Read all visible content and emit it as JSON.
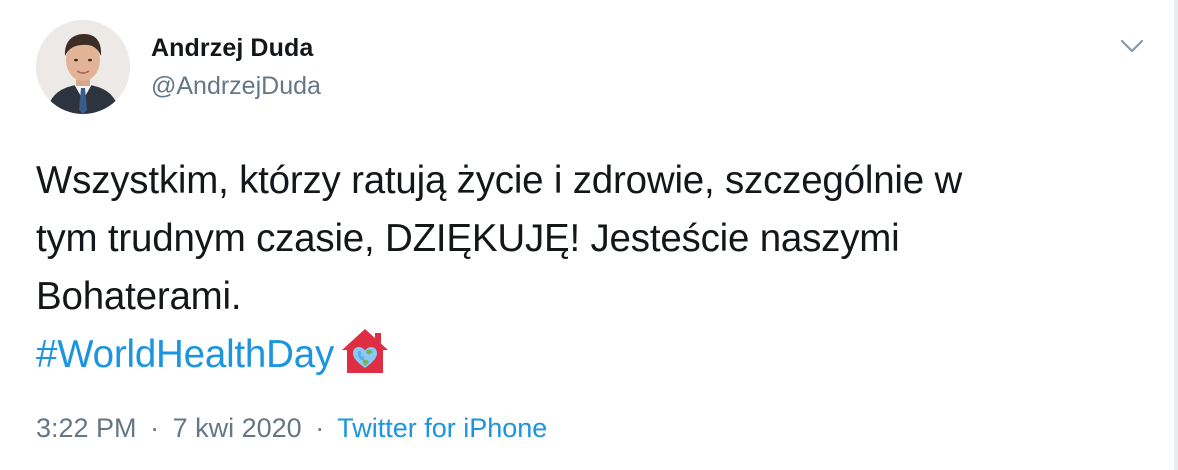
{
  "author": {
    "display_name": "Andrzej Duda",
    "handle": "@AndrzejDuda"
  },
  "tweet": {
    "lines": [
      "Wszystkim, którzy ratują życie i zdrowie, szczególnie w",
      "tym trudnym czasie, DZIĘKUJĘ! Jesteście naszymi",
      "Bohaterami."
    ],
    "hashtag": "#WorldHealthDay",
    "emoji": "house-with-globe-heart"
  },
  "meta": {
    "time": "3:22 PM",
    "separator": "·",
    "date": "7 kwi 2020",
    "separator2": "·",
    "source": "Twitter for iPhone"
  },
  "icons": {
    "menu": "chevron-down-icon"
  },
  "colors": {
    "text": "#14171a",
    "secondary": "#657786",
    "link": "#1b95e0",
    "border": "#e6ecf0",
    "emoji_red": "#dd2e44"
  }
}
